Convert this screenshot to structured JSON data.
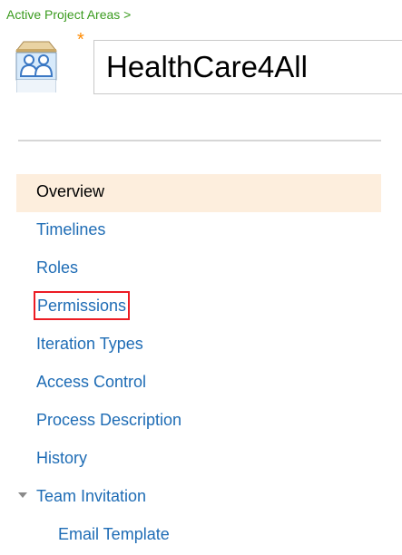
{
  "breadcrumb": "Active Project Areas >",
  "project": {
    "title": "HealthCare4All",
    "required_marker": "*",
    "icon": "team-area-icon"
  },
  "nav": {
    "items": [
      {
        "label": "Overview",
        "selected": true
      },
      {
        "label": "Timelines"
      },
      {
        "label": "Roles"
      },
      {
        "label": "Permissions",
        "highlighted": true
      },
      {
        "label": "Iteration Types"
      },
      {
        "label": "Access Control"
      },
      {
        "label": "Process Description"
      },
      {
        "label": "History"
      },
      {
        "label": "Team Invitation",
        "expanded": true,
        "icon": "chevron-down-icon"
      },
      {
        "label": "Email Template",
        "child": true
      }
    ]
  },
  "colors": {
    "breadcrumb": "#3a9b1e",
    "link": "#1e6cb5",
    "selected_bg": "#fdeedd",
    "highlight_border": "#ec1c24",
    "required_marker": "#ff8a00"
  }
}
